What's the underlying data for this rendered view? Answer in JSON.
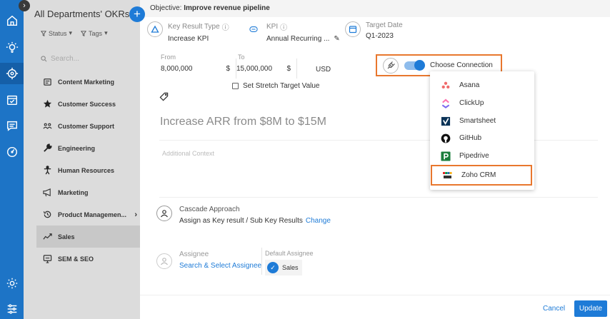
{
  "sidebar": {
    "title": "All Departments' OKRs",
    "add_label": "+",
    "filters": [
      {
        "label": "Status",
        "arrow": "▾"
      },
      {
        "label": "Tags",
        "arrow": "▾"
      }
    ],
    "search_placeholder": "Search...",
    "items": [
      {
        "label": "Content Marketing",
        "icon": "megaphone-icon"
      },
      {
        "label": "Customer Success",
        "icon": "star-icon"
      },
      {
        "label": "Customer Support",
        "icon": "people-icon"
      },
      {
        "label": "Engineering",
        "icon": "wrench-icon"
      },
      {
        "label": "Human Resources",
        "icon": "person-icon"
      },
      {
        "label": "Marketing",
        "icon": "bullhorn-icon"
      },
      {
        "label": "Product Managemen...",
        "icon": "history-icon",
        "chevron": "›"
      },
      {
        "label": "Sales",
        "icon": "trend-icon",
        "active": true
      },
      {
        "label": "SEM & SEO",
        "icon": "monitor-icon"
      }
    ]
  },
  "modal": {
    "objective_prefix": "Objective:",
    "objective_title": "Improve revenue pipeline",
    "key_result_type": {
      "label": "Key Result Type",
      "value": "Increase KPI"
    },
    "kpi": {
      "label": "KPI",
      "value": "Annual Recurring ..."
    },
    "target_date": {
      "label": "Target Date",
      "value": "Q1-2023"
    },
    "from": {
      "label": "From",
      "value": "8,000,000",
      "currency": "$"
    },
    "to": {
      "label": "To",
      "value": "15,000,000",
      "currency": "$"
    },
    "unit": "USD",
    "stretch_label": "Set Stretch Target Value",
    "title_value": "Increase ARR from $8M to $15M",
    "context_placeholder": "Additional Context",
    "cascade": {
      "title": "Cascade Approach",
      "text": "Assign as Key result / Sub Key Results",
      "link": "Change"
    },
    "assignee": {
      "title": "Assignee",
      "link": "Search & Select Assignee"
    },
    "default_assignee": {
      "title": "Default Assignee",
      "value": "Sales"
    },
    "cancel_label": "Cancel",
    "update_label": "Update"
  },
  "connection": {
    "label": "Choose Connection",
    "options": [
      "Asana",
      "ClickUp",
      "Smartsheet",
      "GitHub",
      "Pipedrive",
      "Zoho CRM"
    ],
    "highlighted": "Zoho CRM"
  },
  "colors": {
    "rail": "#1d74c6",
    "accent": "#1e7bd7",
    "highlight_border": "#e8772e",
    "sidebar_bg": "#dcdcdc"
  }
}
